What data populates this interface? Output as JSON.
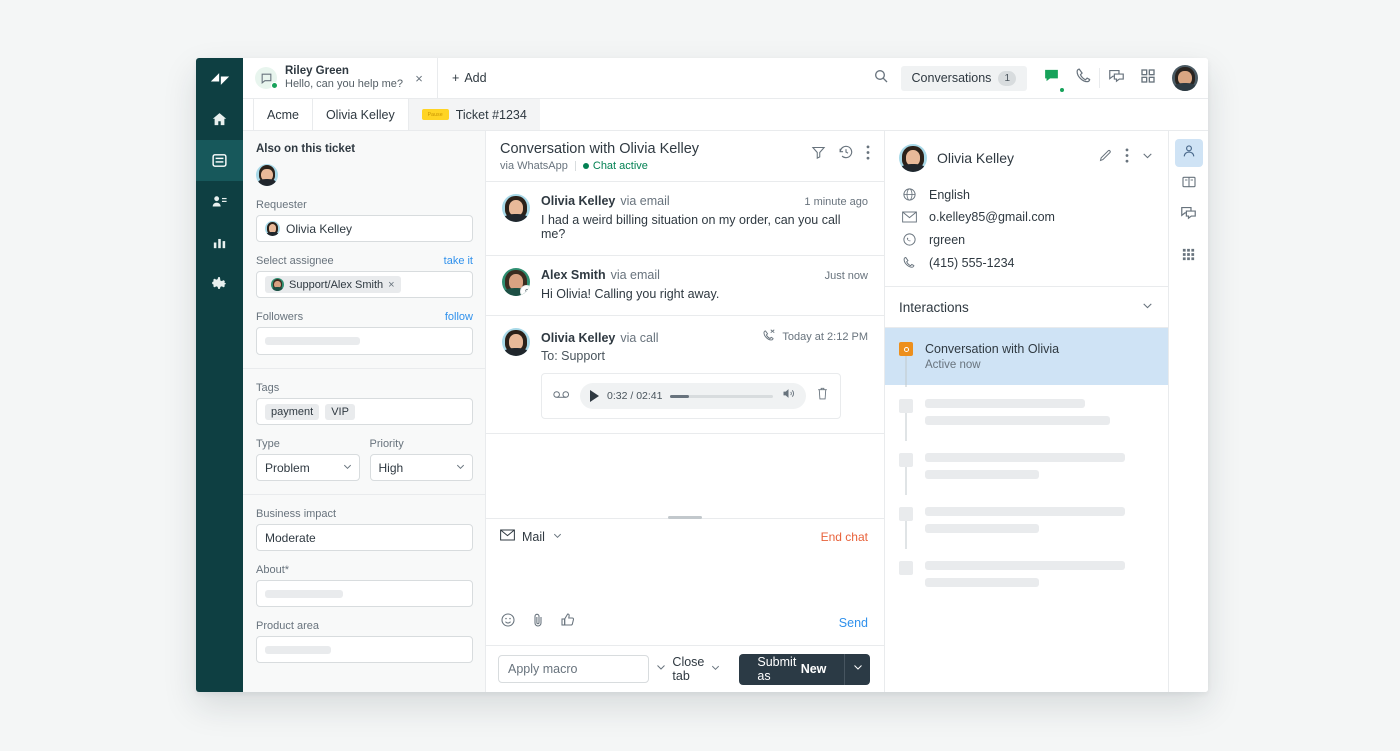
{
  "nav_rail": {
    "logo": "zendesk-logo",
    "items": [
      {
        "name": "home",
        "icon": "home-icon",
        "active": false
      },
      {
        "name": "views",
        "icon": "views-icon",
        "active": true
      },
      {
        "name": "customers",
        "icon": "customers-icon",
        "active": false
      },
      {
        "name": "reporting",
        "icon": "reporting-icon",
        "active": false
      },
      {
        "name": "settings",
        "icon": "gear-icon",
        "active": false
      }
    ]
  },
  "topbar": {
    "tab": {
      "title": "Riley Green",
      "subtitle": "Hello, can you help me?",
      "close": "×",
      "status": "online"
    },
    "add_label": "Add",
    "add_plus": "+",
    "search_icon": "search-icon",
    "conversations_label": "Conversations",
    "conversations_count": "1",
    "icons": [
      "chat-icon",
      "phone-icon",
      "messaging-icon",
      "apps-grid-icon"
    ],
    "avatar": "agent-avatar"
  },
  "breadcrumb": {
    "items": [
      "Acme",
      "Olivia Kelley"
    ],
    "current": "Ticket #1234",
    "badge_text": "Pause"
  },
  "sidebar": {
    "also_on_ticket": "Also on this ticket",
    "requester_label": "Requester",
    "requester_value": "Olivia Kelley",
    "assignee_label": "Select assignee",
    "assignee_action": "take it",
    "assignee_token": "Support/Alex Smith",
    "assignee_token_remove": "×",
    "followers_label": "Followers",
    "followers_action": "follow",
    "followers_value": "",
    "tags_label": "Tags",
    "tags": [
      "payment",
      "VIP"
    ],
    "type_label": "Type",
    "type_value": "Problem",
    "priority_label": "Priority",
    "priority_value": "High",
    "business_impact_label": "Business impact",
    "business_impact_value": "Moderate",
    "about_label": "About*",
    "about_value": "",
    "product_area_label": "Product area",
    "product_area_value": ""
  },
  "conversation": {
    "title": "Conversation with Olivia Kelley",
    "via": "via WhatsApp",
    "status": "Chat active",
    "header_icons": [
      "filter-icon",
      "history-icon",
      "more-vertical-icon"
    ],
    "messages": [
      {
        "author": "Olivia Kelley",
        "via": "via email",
        "time": "1 minute ago",
        "text": "I had a weird billing situation on my order, can you call me?",
        "avatar": "olivia"
      },
      {
        "author": "Alex Smith",
        "via": "via email",
        "time": "Just now",
        "text": "Hi Olivia! Calling you right away.",
        "avatar": "alex"
      },
      {
        "author": "Olivia Kelley",
        "via": "via call",
        "time": "Today at 2:12 PM",
        "time_icon": "missed-call-icon",
        "to": "To: Support",
        "avatar": "olivia",
        "audio": {
          "voicemail_icon": "voicemail-icon",
          "play_icon": "play-icon",
          "time": "0:32 / 02:41",
          "volume_icon": "volume-icon",
          "delete_icon": "trash-icon",
          "progress_percent": 18
        }
      }
    ],
    "composer": {
      "channel": "Mail",
      "channel_icon": "mail-icon",
      "end_chat": "End chat",
      "tools": [
        "emoji-icon",
        "attachment-icon",
        "thumbs-up-icon"
      ],
      "send": "Send",
      "placeholder": ""
    }
  },
  "actionbar": {
    "macro_placeholder": "Apply macro",
    "close_tab": "Close tab",
    "submit_prefix": "Submit as ",
    "submit_state": "New"
  },
  "customer": {
    "name": "Olivia Kelley",
    "actions": [
      "edit-pencil-icon",
      "more-vertical-icon",
      "chevron-down-icon"
    ],
    "fields": [
      {
        "icon": "globe-icon",
        "value": "English"
      },
      {
        "icon": "mail-icon",
        "value": "o.kelley85@gmail.com"
      },
      {
        "icon": "whatsapp-icon",
        "value": "rgreen"
      },
      {
        "icon": "phone-icon",
        "value": "(415) 555-1234"
      }
    ],
    "interactions_title": "Interactions",
    "interactions": [
      {
        "title": "Conversation with Olivia",
        "subtitle": "Active now",
        "active": true
      },
      {
        "title": "",
        "subtitle": "",
        "active": false
      },
      {
        "title": "",
        "subtitle": "",
        "active": false
      },
      {
        "title": "",
        "subtitle": "",
        "active": false
      },
      {
        "title": "",
        "subtitle": "",
        "active": false
      }
    ]
  },
  "right_rail": {
    "items": [
      {
        "name": "user",
        "icon": "user-icon",
        "active": true
      },
      {
        "name": "knowledge",
        "icon": "book-icon",
        "active": false
      },
      {
        "name": "messaging",
        "icon": "messaging-icon",
        "active": false
      },
      {
        "name": "apps",
        "icon": "apps-grid-icon",
        "active": false
      }
    ]
  },
  "colors": {
    "nav_bg": "#0e3f42",
    "nav_active": "#17585b",
    "accent_blue": "#3091ec",
    "accent_orange": "#e8623b",
    "marker_orange": "#ed8f1c",
    "submit_dark": "#2b3a45",
    "highlight_blue": "#cfe3f5",
    "badge_yellow": "#ffd424",
    "green_status": "#038153",
    "page_bg": "#f4f6f6"
  }
}
